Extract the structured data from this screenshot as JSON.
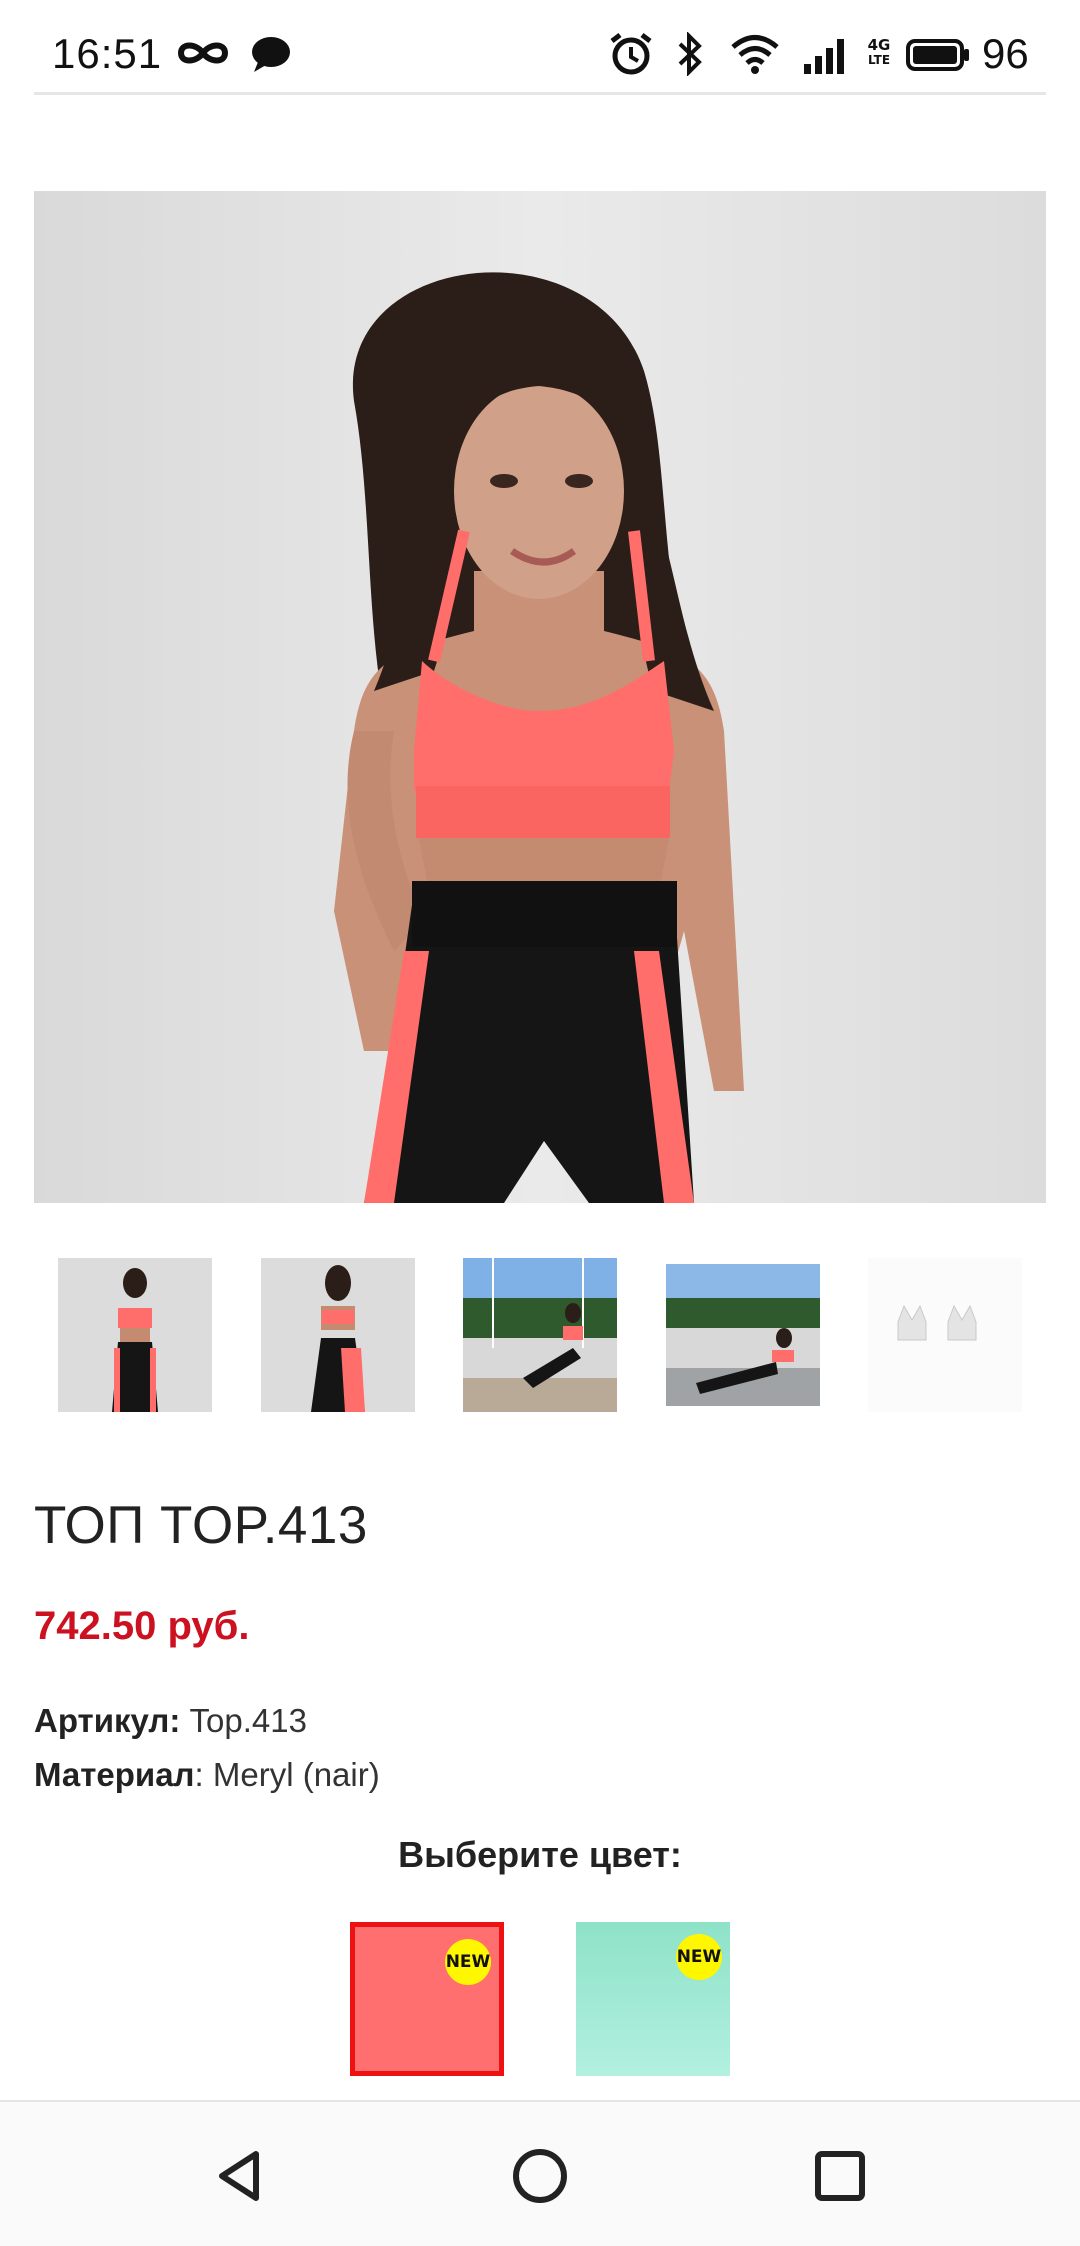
{
  "status_bar": {
    "time": "16:51",
    "battery_percent": "96",
    "network_label_top": "4G",
    "network_label_bottom": "LTE",
    "icons": [
      "infinity-icon",
      "chat-bubble-icon",
      "alarm-icon",
      "bluetooth-icon",
      "wifi-icon",
      "signal-icon",
      "battery-icon"
    ]
  },
  "product": {
    "title": "ТОП TOP.413",
    "price": "742.50 руб.",
    "article_label": "Артикул:",
    "article_value": " Top.413",
    "material_label": "Материал",
    "material_value": ": Meryl (nair)"
  },
  "gallery": {
    "thumbnails": [
      "front-view",
      "back-view",
      "outdoor-sitting",
      "outdoor-lying",
      "product-only"
    ]
  },
  "color_picker": {
    "heading": "Выберите цвет:",
    "swatches": [
      {
        "color": "#ff6f6f",
        "badge": "NEW",
        "selected": true
      },
      {
        "color": "#a3ead6",
        "badge": "NEW",
        "selected": false
      }
    ],
    "selected_border_color": "#ee1111"
  },
  "colors": {
    "price": "#cc1121",
    "badge": "#fff700"
  },
  "nav_bar": {
    "buttons": [
      "back",
      "home",
      "recents"
    ]
  }
}
